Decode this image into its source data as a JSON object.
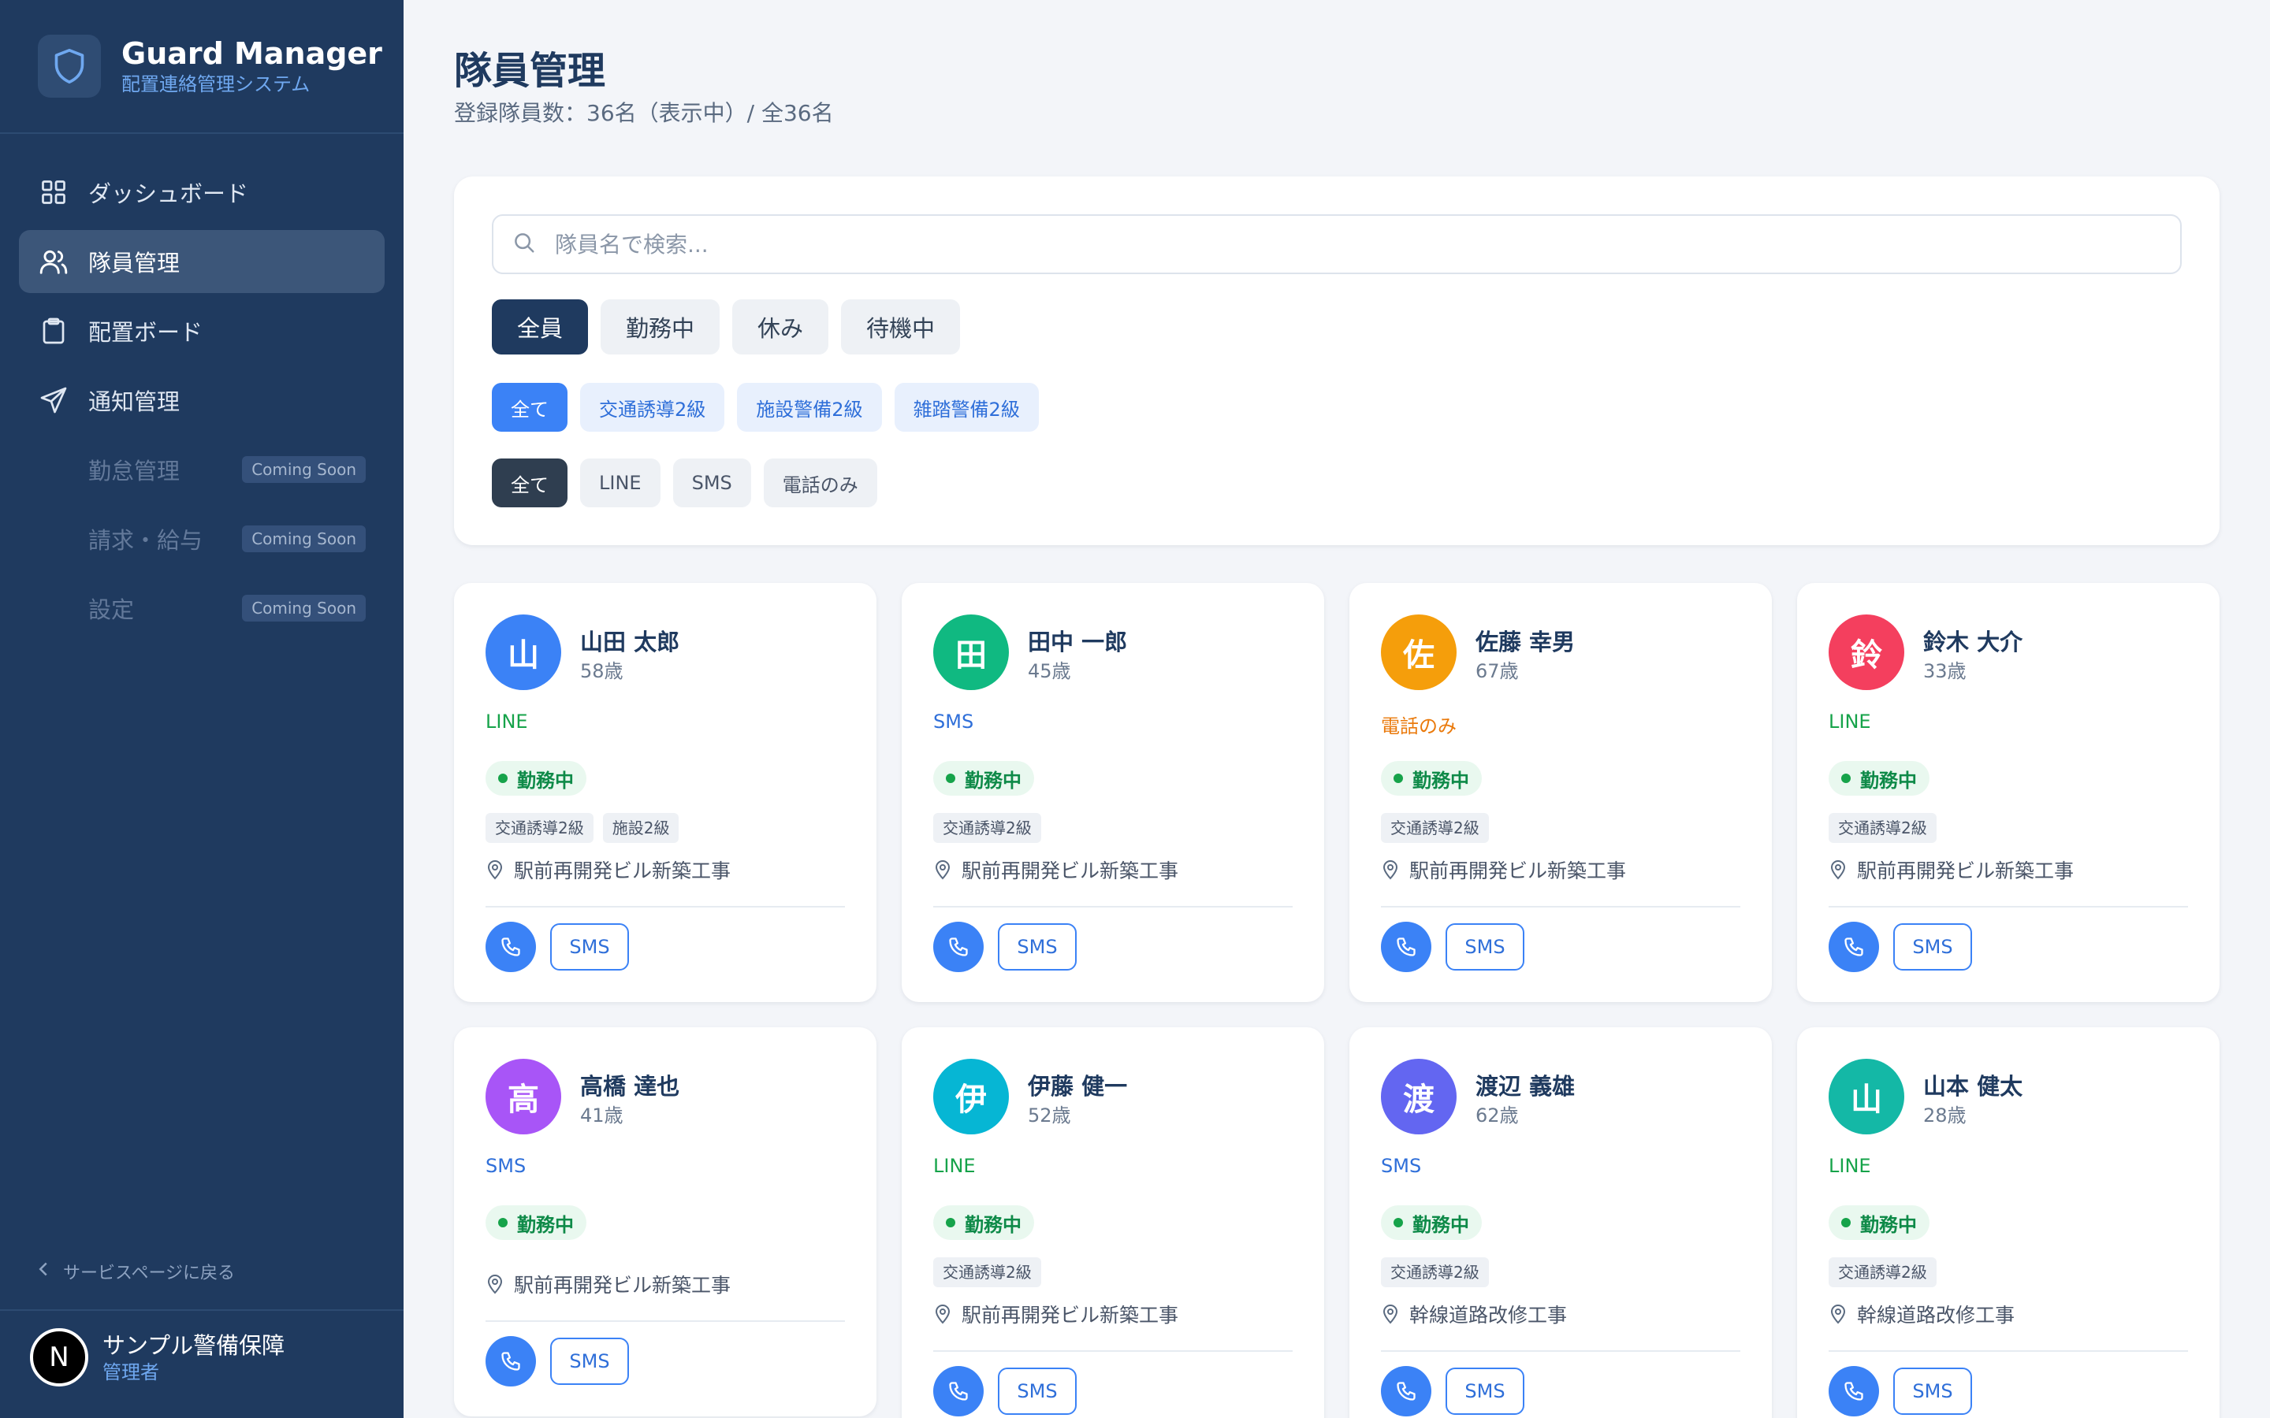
{
  "app": {
    "title": "Guard Manager",
    "subtitle": "配置連絡管理システム"
  },
  "nav": [
    {
      "label": "ダッシュボード",
      "icon": "grid-icon"
    },
    {
      "label": "隊員管理",
      "icon": "users-icon",
      "active": true
    },
    {
      "label": "配置ボード",
      "icon": "clipboard-icon"
    },
    {
      "label": "通知管理",
      "icon": "send-icon"
    },
    {
      "label": "勤怠管理",
      "badge": "Coming Soon"
    },
    {
      "label": "請求・給与",
      "badge": "Coming Soon"
    },
    {
      "label": "設定",
      "badge": "Coming Soon"
    }
  ],
  "back_link": "サービスページに戻る",
  "user": {
    "initial": "N",
    "name": "サンプル警備保障",
    "role": "管理者"
  },
  "page": {
    "title": "隊員管理",
    "subtitle": "登録隊員数：36名（表示中）/ 全36名"
  },
  "search": {
    "placeholder": "隊員名で検索..."
  },
  "filters": {
    "status": [
      "全員",
      "勤務中",
      "休み",
      "待機中"
    ],
    "status_selected": "全員",
    "qualification": [
      "全て",
      "交通誘導2級",
      "施設警備2級",
      "雑踏警備2級"
    ],
    "qualification_selected": "全て",
    "contact": [
      "全て",
      "LINE",
      "SMS",
      "電話のみ"
    ],
    "contact_selected": "全て"
  },
  "colors": {
    "sidebar": "#1f3a5f",
    "accent": "#3b82f6",
    "status_green": "#16a34a",
    "contact_line": "#16a34a",
    "contact_sms": "#2f6fd9",
    "contact_phone": "#ea7a0c"
  },
  "guards": [
    {
      "initial": "山",
      "name": "山田 太郎",
      "age": "58歳",
      "contact": "LINE",
      "status": "勤務中",
      "quals": [
        "交通誘導2級",
        "施設2級"
      ],
      "site": "駅前再開発ビル新築工事",
      "color": "#3b82f6",
      "sms": "SMS"
    },
    {
      "initial": "田",
      "name": "田中 一郎",
      "age": "45歳",
      "contact": "SMS",
      "status": "勤務中",
      "quals": [
        "交通誘導2級"
      ],
      "site": "駅前再開発ビル新築工事",
      "color": "#10b981",
      "sms": "SMS"
    },
    {
      "initial": "佐",
      "name": "佐藤 幸男",
      "age": "67歳",
      "contact": "電話のみ",
      "status": "勤務中",
      "quals": [
        "交通誘導2級"
      ],
      "site": "駅前再開発ビル新築工事",
      "color": "#f59e0b",
      "sms": "SMS"
    },
    {
      "initial": "鈴",
      "name": "鈴木 大介",
      "age": "33歳",
      "contact": "LINE",
      "status": "勤務中",
      "quals": [
        "交通誘導2級"
      ],
      "site": "駅前再開発ビル新築工事",
      "color": "#f43f5e",
      "sms": "SMS"
    },
    {
      "initial": "高",
      "name": "高橋 達也",
      "age": "41歳",
      "contact": "SMS",
      "status": "勤務中",
      "quals": [],
      "site": "駅前再開発ビル新築工事",
      "color": "#a855f7",
      "sms": "SMS"
    },
    {
      "initial": "伊",
      "name": "伊藤 健一",
      "age": "52歳",
      "contact": "LINE",
      "status": "勤務中",
      "quals": [
        "交通誘導2級"
      ],
      "site": "駅前再開発ビル新築工事",
      "color": "#06b6d4",
      "sms": "SMS"
    },
    {
      "initial": "渡",
      "name": "渡辺 義雄",
      "age": "62歳",
      "contact": "SMS",
      "status": "勤務中",
      "quals": [
        "交通誘導2級"
      ],
      "site": "幹線道路改修工事",
      "color": "#6366f1",
      "sms": "SMS"
    },
    {
      "initial": "山",
      "name": "山本 健太",
      "age": "28歳",
      "contact": "LINE",
      "status": "勤務中",
      "quals": [
        "交通誘導2級"
      ],
      "site": "幹線道路改修工事",
      "color": "#14b8a6",
      "sms": "SMS"
    }
  ]
}
